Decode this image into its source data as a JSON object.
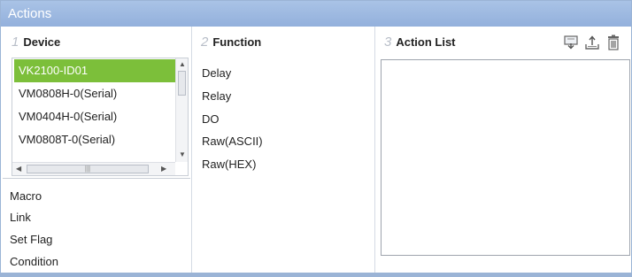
{
  "window": {
    "title": "Actions"
  },
  "device_panel": {
    "number": "1",
    "title": "Device",
    "devices": [
      {
        "label": "VK2100-ID01",
        "selected": true
      },
      {
        "label": "VM0808H-0(Serial)",
        "selected": false
      },
      {
        "label": "VM0404H-0(Serial)",
        "selected": false
      },
      {
        "label": "VM0808T-0(Serial)",
        "selected": false
      }
    ],
    "commands": [
      "Macro",
      "Link",
      "Set Flag",
      "Condition"
    ]
  },
  "function_panel": {
    "number": "2",
    "title": "Function",
    "items": [
      "Delay",
      "Relay",
      "DO",
      "Raw(ASCII)",
      "Raw(HEX)"
    ]
  },
  "action_panel": {
    "number": "3",
    "title": "Action List",
    "toolbar_icons": [
      "monitor-download-icon",
      "tray-upload-icon",
      "trash-icon"
    ],
    "items": []
  },
  "colors": {
    "selected_row": "#7cbf3a",
    "titlebar": "#9bb4d6"
  }
}
